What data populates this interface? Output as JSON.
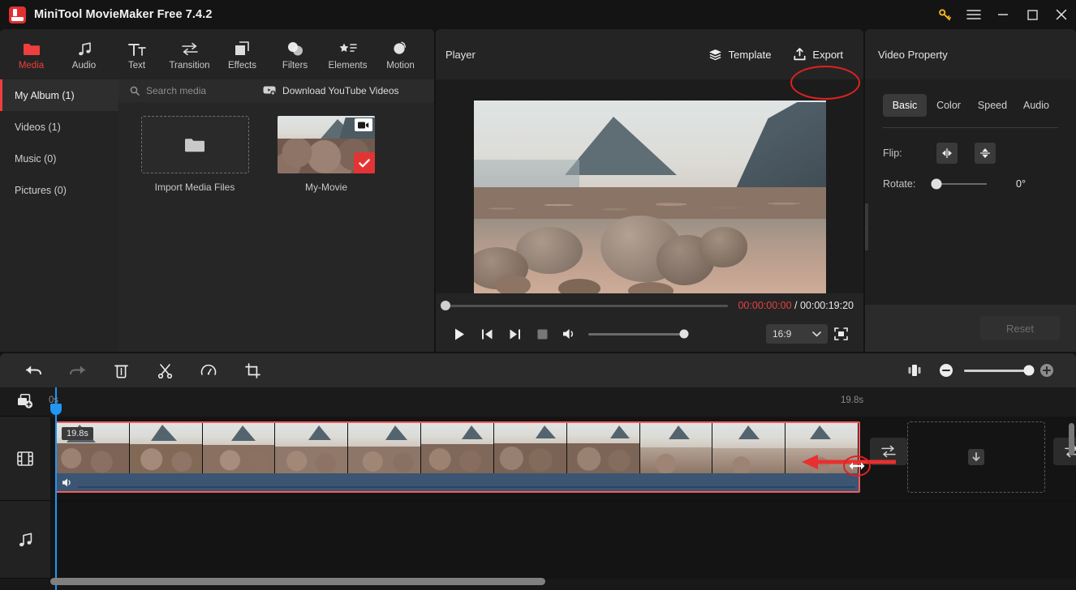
{
  "window": {
    "title": "MiniTool MovieMaker Free 7.4.2",
    "logo_name": "app-logo",
    "controls": [
      {
        "name": "key-icon",
        "label": ""
      },
      {
        "name": "menu-icon",
        "label": ""
      },
      {
        "name": "minimize-icon",
        "label": ""
      },
      {
        "name": "maximize-icon",
        "label": ""
      },
      {
        "name": "close-icon",
        "label": ""
      }
    ]
  },
  "toolbar": {
    "items": [
      {
        "label": "Media",
        "icon": "folder-icon",
        "active": true
      },
      {
        "label": "Audio",
        "icon": "music-note-icon",
        "active": false
      },
      {
        "label": "Text",
        "icon": "text-icon",
        "active": false
      },
      {
        "label": "Transition",
        "icon": "transition-arrows-icon",
        "active": false
      },
      {
        "label": "Effects",
        "icon": "layers-square-icon",
        "active": false
      },
      {
        "label": "Filters",
        "icon": "filters-circles-icon",
        "active": false
      },
      {
        "label": "Elements",
        "icon": "star-list-icon",
        "active": false
      },
      {
        "label": "Motion",
        "icon": "motion-circle-icon",
        "active": false
      }
    ]
  },
  "library": {
    "albums": [
      {
        "label": "My Album (1)",
        "active": true
      },
      {
        "label": "Videos (1)",
        "active": false
      },
      {
        "label": "Music (0)",
        "active": false
      },
      {
        "label": "Pictures (0)",
        "active": false
      }
    ],
    "search_placeholder": "Search media",
    "search_value": "",
    "download_youtube_label": "Download YouTube Videos",
    "import_label": "Import Media Files",
    "media_items": [
      {
        "label": "My-Movie",
        "selected": true,
        "type": "video"
      }
    ]
  },
  "player": {
    "title": "Player",
    "template_label": "Template",
    "export_label": "Export",
    "current_time": "00:00:00:00",
    "separator": " / ",
    "total_time": "00:00:19:20",
    "seek_percent": 0,
    "volume_percent": 100,
    "aspect_ratio": "16:9",
    "controls": [
      {
        "name": "play-button"
      },
      {
        "name": "previous-frame-button"
      },
      {
        "name": "next-frame-button"
      },
      {
        "name": "stop-button"
      },
      {
        "name": "volume-icon"
      }
    ]
  },
  "properties": {
    "title": "Video Property",
    "tabs": [
      {
        "label": "Basic",
        "active": true
      },
      {
        "label": "Color",
        "active": false
      },
      {
        "label": "Speed",
        "active": false
      },
      {
        "label": "Audio",
        "active": false
      }
    ],
    "flip_label": "Flip:",
    "rotate_label": "Rotate:",
    "rotate_value": "0°",
    "rotate_percent": 0,
    "reset_label": "Reset",
    "reset_enabled": false
  },
  "timeline": {
    "tools": [
      {
        "name": "undo-button",
        "enabled": true
      },
      {
        "name": "redo-button",
        "enabled": false
      },
      {
        "name": "delete-button",
        "enabled": true
      },
      {
        "name": "split-button",
        "enabled": true
      },
      {
        "name": "speed-button",
        "enabled": true
      },
      {
        "name": "crop-button",
        "enabled": true
      }
    ],
    "zoom_percent": 100,
    "ruler_start": "0s",
    "ruler_end": "19.8s",
    "clip_duration": "19.8s",
    "frame_count": 11,
    "tracks": [
      {
        "name": "video-track",
        "icon": "film-icon"
      },
      {
        "name": "audio-track",
        "icon": "music-note-icon"
      }
    ]
  },
  "colors": {
    "accent_red": "#ef3e3e",
    "annotation_red": "#e02020",
    "playhead_blue": "#2196f3",
    "clip_border": "#f25c5c",
    "audio_strip": "#3b5573",
    "panel_bg": "#242424",
    "app_bg": "#141414"
  }
}
